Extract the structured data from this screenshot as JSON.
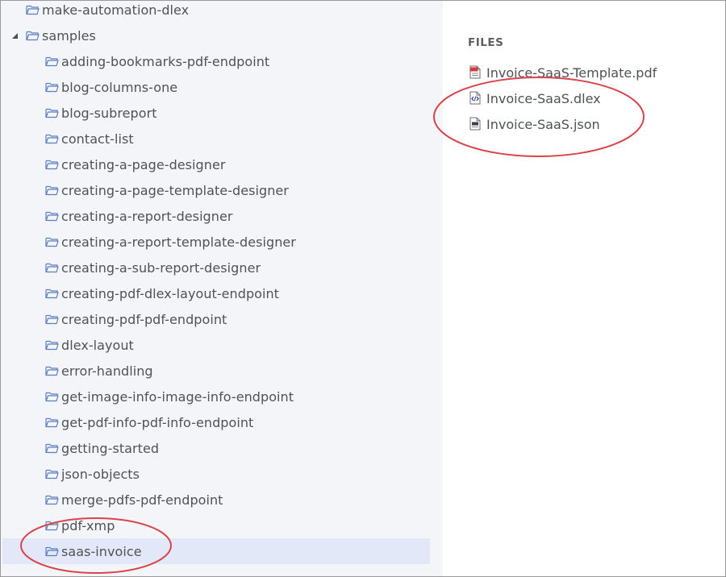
{
  "tree": {
    "root_items": [
      {
        "label": "make-automation-dlex"
      },
      {
        "label": "samples",
        "expanded": true
      }
    ],
    "children": [
      {
        "label": "adding-bookmarks-pdf-endpoint"
      },
      {
        "label": "blog-columns-one"
      },
      {
        "label": "blog-subreport"
      },
      {
        "label": "contact-list"
      },
      {
        "label": "creating-a-page-designer"
      },
      {
        "label": "creating-a-page-template-designer"
      },
      {
        "label": "creating-a-report-designer"
      },
      {
        "label": "creating-a-report-template-designer"
      },
      {
        "label": "creating-a-sub-report-designer"
      },
      {
        "label": "creating-pdf-dlex-layout-endpoint"
      },
      {
        "label": "creating-pdf-pdf-endpoint"
      },
      {
        "label": "dlex-layout"
      },
      {
        "label": "error-handling"
      },
      {
        "label": "get-image-info-image-info-endpoint"
      },
      {
        "label": "get-pdf-info-pdf-info-endpoint"
      },
      {
        "label": "getting-started"
      },
      {
        "label": "json-objects"
      },
      {
        "label": "merge-pdfs-pdf-endpoint"
      },
      {
        "label": "pdf-xmp"
      },
      {
        "label": "saas-invoice",
        "selected": true
      }
    ]
  },
  "files": {
    "heading": "FILES",
    "items": [
      {
        "label": "Invoice-SaaS-Template.pdf",
        "icon": "pdf-file-icon"
      },
      {
        "label": "Invoice-SaaS.dlex",
        "icon": "dlex-file-icon"
      },
      {
        "label": "Invoice-SaaS.json",
        "icon": "json-file-icon"
      }
    ]
  },
  "colors": {
    "annotation": "#d9434a",
    "selected_bg": "#e2e8f7",
    "tree_bg": "#f4f5f8",
    "text": "#4f5256"
  }
}
